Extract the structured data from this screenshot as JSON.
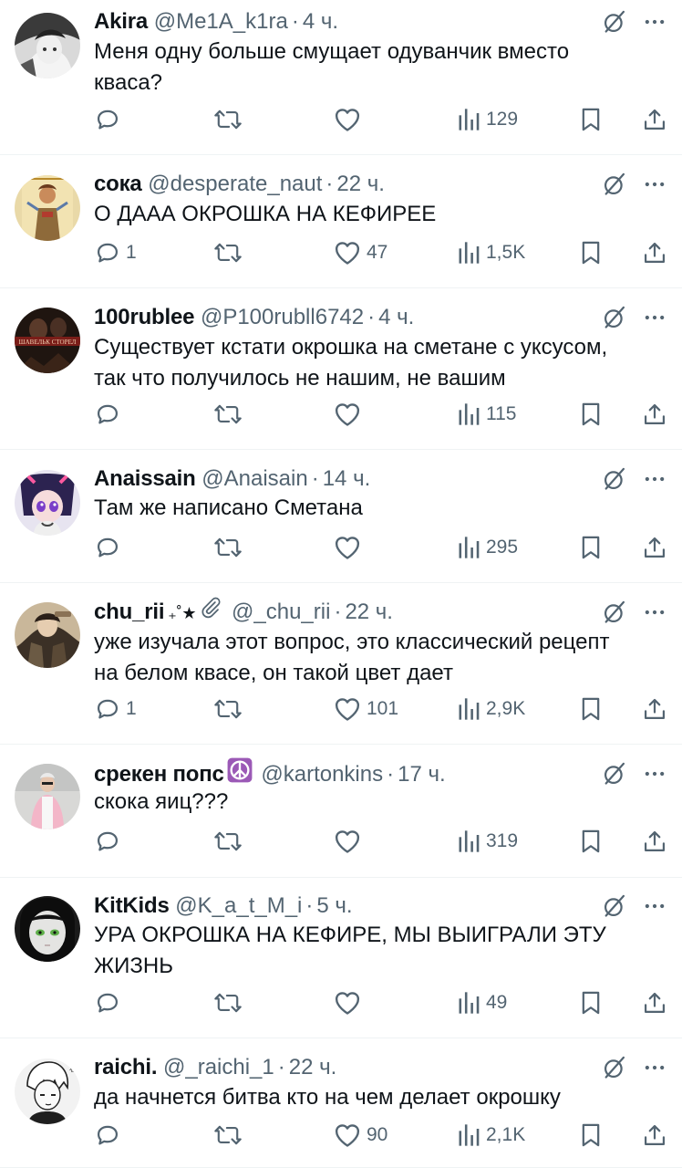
{
  "tweets": [
    {
      "name": "Akira",
      "handle": "@Me1A_k1ra",
      "dot": "·",
      "time": "4 ч.",
      "text": "Меня одну больше смущает одуванчик вместо\nкваса?",
      "replies": "",
      "reposts": "",
      "likes": "",
      "views": "129",
      "avatar": "monochrome-anime-girl"
    },
    {
      "name": "сока",
      "handle": "@desperate_naut",
      "dot": "·",
      "time": "22 ч.",
      "text": "О ДААА ОКРОШКА НА КЕФИРЕЕ",
      "replies": "1",
      "reposts": "",
      "likes": "47",
      "views": "1,5K",
      "avatar": "tarot-card-figure"
    },
    {
      "name": "100rublee",
      "handle": "@P100rubll6742",
      "dot": "·",
      "time": "4 ч.",
      "text": "Существует кстати окрошка на сметане с уксусом,\nтак что получилось не нашим, не вашим",
      "replies": "",
      "reposts": "",
      "likes": "",
      "views": "115",
      "avatar": "dark-poster",
      "avatar_text": "ШАВЕЛЬК СТОРЕЛ"
    },
    {
      "name": "Anaissain",
      "handle": "@Anaisain",
      "dot": "·",
      "time": "14 ч.",
      "text": "Там же написано Сметана",
      "replies": "",
      "reposts": "",
      "likes": "",
      "views": "295",
      "avatar": "anime-character-purple"
    },
    {
      "name": "chu_rii",
      "name_suffix": "₊˚★",
      "handle": "@_chu_rii",
      "dot": "·",
      "time": "22 ч.",
      "text": "уже изучала этот вопрос, это классический рецепт\nна белом квасе, он такой цвет дает",
      "replies": "1",
      "reposts": "",
      "likes": "101",
      "views": "2,9K",
      "avatar": "illustrated-character",
      "badge_icon": "paperclip-icon"
    },
    {
      "name": "срекен попс",
      "handle": "@kartonkins",
      "dot": "·",
      "time": "17 ч.",
      "text": "скока яиц???",
      "replies": "",
      "reposts": "",
      "likes": "",
      "views": "319",
      "avatar": "person-pink-coat",
      "badge_icon": "peace-symbol-icon"
    },
    {
      "name": "KitKids",
      "handle": "@K_a_t_M_i",
      "dot": "·",
      "time": "5 ч.",
      "text": "УРА ОКРОШКА НА КЕФИРЕ, МЫ ВЫИГРАЛИ ЭТУ\nЖИЗНЬ",
      "replies": "",
      "reposts": "",
      "likes": "",
      "views": "49",
      "avatar": "doll-face-green-eyes"
    },
    {
      "name": "raichi.",
      "handle": "@_raichi_1",
      "dot": "·",
      "time": "22 ч.",
      "text": "да начнется битва кто на чем делает окрошку",
      "replies": "",
      "reposts": "",
      "likes": "90",
      "views": "2,1K",
      "avatar": "manga-boy-sketch"
    }
  ],
  "colors": {
    "text": "#0f1419",
    "secondary": "#536471",
    "divider": "#eff3f4",
    "peace_badge": "#8e44ad"
  }
}
